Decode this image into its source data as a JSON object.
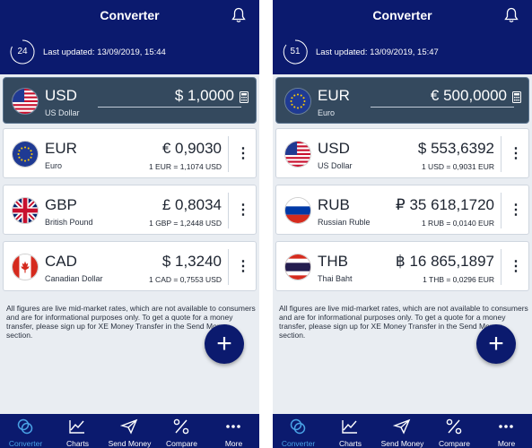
{
  "screens": [
    {
      "title": "Converter",
      "timer": "24",
      "updated": "Last updated: 13/09/2019, 15:44",
      "base": {
        "code": "USD",
        "name": "US Dollar",
        "amount": "$ 1,0000",
        "flag": "us"
      },
      "rows": [
        {
          "code": "EUR",
          "name": "Euro",
          "value": "€ 0,9030",
          "rate": "1 EUR = 1,1074 USD",
          "flag": "eu"
        },
        {
          "code": "GBP",
          "name": "British Pound",
          "value": "£ 0,8034",
          "rate": "1 GBP = 1,2448 USD",
          "flag": "gb"
        },
        {
          "code": "CAD",
          "name": "Canadian Dollar",
          "value": "$ 1,3240",
          "rate": "1 CAD = 0,7553 USD",
          "flag": "ca"
        }
      ]
    },
    {
      "title": "Converter",
      "timer": "51",
      "updated": "Last updated: 13/09/2019, 15:47",
      "base": {
        "code": "EUR",
        "name": "Euro",
        "amount": "€ 500,0000",
        "flag": "eu"
      },
      "rows": [
        {
          "code": "USD",
          "name": "US Dollar",
          "value": "$ 553,6392",
          "rate": "1 USD = 0,9031 EUR",
          "flag": "us"
        },
        {
          "code": "RUB",
          "name": "Russian Ruble",
          "value": "₽ 35 618,1720",
          "rate": "1 RUB = 0,0140 EUR",
          "flag": "ru"
        },
        {
          "code": "THB",
          "name": "Thai Baht",
          "value": "฿ 16 865,1897",
          "rate": "1 THB = 0,0296 EUR",
          "flag": "th"
        }
      ]
    }
  ],
  "disclaimer": "All figures are live mid-market rates, which are not available to consumers and are for informational purposes only. To get a quote for a money transfer, please sign up for XE Money Transfer in the Send Money section.",
  "tabs": [
    {
      "label": "Converter",
      "icon": "coins-icon",
      "active": true
    },
    {
      "label": "Charts",
      "icon": "chart-icon",
      "active": false
    },
    {
      "label": "Send Money",
      "icon": "send-icon",
      "active": false
    },
    {
      "label": "Compare",
      "icon": "percent-icon",
      "active": false
    },
    {
      "label": "More",
      "icon": "more-icon",
      "active": false
    }
  ],
  "fab_label": "+",
  "more_label": "⋮",
  "colors": {
    "primary": "#0b1a6e",
    "base_card": "#34495e",
    "background": "#e9edf2",
    "active_tab": "#4aa3e6"
  }
}
